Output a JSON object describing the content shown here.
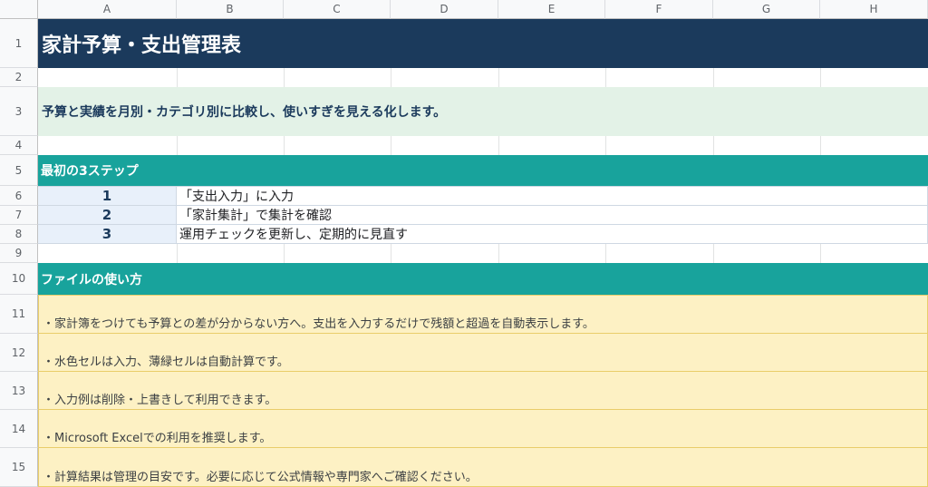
{
  "columns": [
    "A",
    "B",
    "C",
    "D",
    "E",
    "F",
    "G",
    "H"
  ],
  "rows": [
    "1",
    "2",
    "3",
    "4",
    "5",
    "6",
    "7",
    "8",
    "9",
    "10",
    "11",
    "12",
    "13",
    "14",
    "15"
  ],
  "title": "家計予算・支出管理表",
  "description": "予算と実績を月別・カテゴリ別に比較し、使いすぎを見える化します。",
  "steps_section": {
    "heading": "最初の3ステップ",
    "steps": [
      {
        "num": "1",
        "text": "「支出入力」に入力"
      },
      {
        "num": "2",
        "text": "「家計集計」で集計を確認"
      },
      {
        "num": "3",
        "text": "運用チェックを更新し、定期的に見直す"
      }
    ]
  },
  "usage_section": {
    "heading": "ファイルの使い方",
    "notes": [
      "・家計簿をつけても予算との差が分からない方へ。支出を入力するだけで残額と超過を自動表示します。",
      "・水色セルは入力、薄緑セルは自動計算です。",
      "・入力例は削除・上書きして利用できます。",
      "・Microsoft Excelでの利用を推奨します。",
      "・計算結果は管理の目安です。必要に応じて公式情報や専門家へご確認ください。"
    ]
  },
  "colors": {
    "title_bg": "#1b3a5c",
    "section_bg": "#18a39c",
    "desc_bg": "#e3f2e7",
    "note_bg": "#fdf1c4",
    "step_num_bg": "#e8f0fa"
  }
}
